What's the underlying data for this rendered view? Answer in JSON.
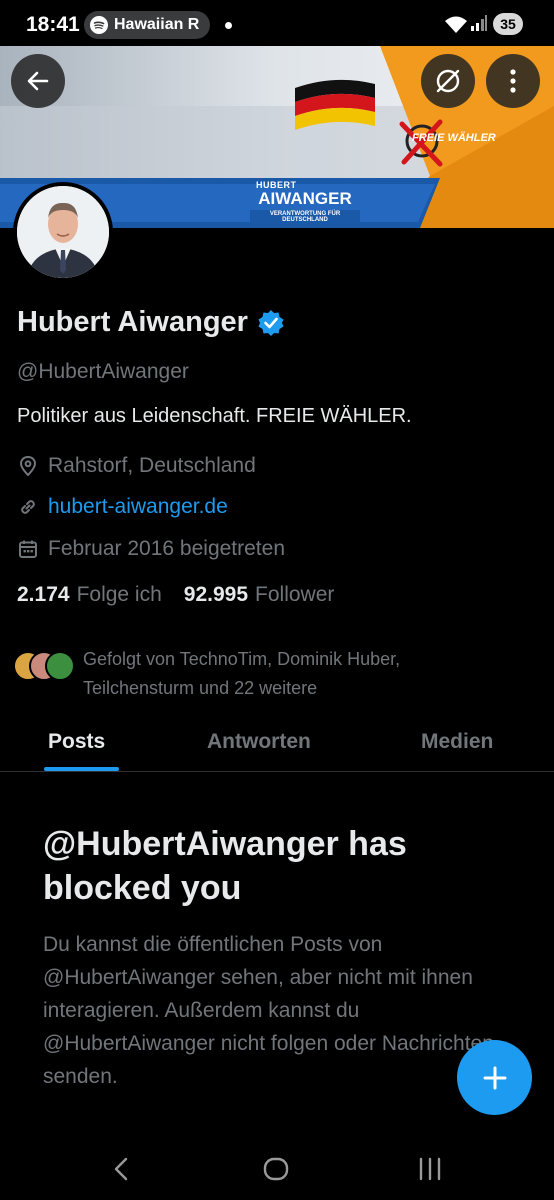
{
  "status_bar": {
    "time": "18:41",
    "media_title": "Hawaiian R",
    "battery": "35",
    "icons": [
      "spotify-icon",
      "wifi-icon",
      "signal-icon"
    ]
  },
  "banner": {
    "first_name": "HUBERT",
    "last_name": "AIWANGER",
    "tagline": "VERANTWORTUNG FÜR DEUTSCHLAND",
    "logo_text": "FREIE WÄHLER"
  },
  "profile": {
    "display_name": "Hubert Aiwanger",
    "handle": "@HubertAiwanger",
    "bio": "Politiker aus Leidenschaft. FREIE WÄHLER.",
    "location": "Rahstorf, Deutschland",
    "website": "hubert-aiwanger.de",
    "joined": "Februar 2016 beigetreten",
    "following_count": "2.174",
    "following_label": "Folge ich",
    "followers_count": "92.995",
    "followers_label": "Follower",
    "followed_by_line1": "Gefolgt von TechnoTim, Dominik Huber,",
    "followed_by_line2": "Teilchensturm und 22 weitere"
  },
  "tabs": [
    {
      "label": "Posts",
      "active": true
    },
    {
      "label": "Antworten",
      "active": false
    },
    {
      "label": "Medien",
      "active": false
    }
  ],
  "blocked": {
    "title": "@HubertAiwanger has blocked you",
    "body": "Du kannst die öffentlichen Posts von @HubertAiwanger sehen, aber nicht mit ihnen interagieren. Außerdem kannst du @HubertAiwanger nicht folgen oder Nachrichten senden."
  },
  "colors": {
    "accent": "#1d9bf0",
    "background": "#000000",
    "text_primary": "#e7e9ea",
    "text_secondary": "#71767b",
    "banner_orange": "#f29a1d",
    "banner_blue": "#1a58a8"
  }
}
